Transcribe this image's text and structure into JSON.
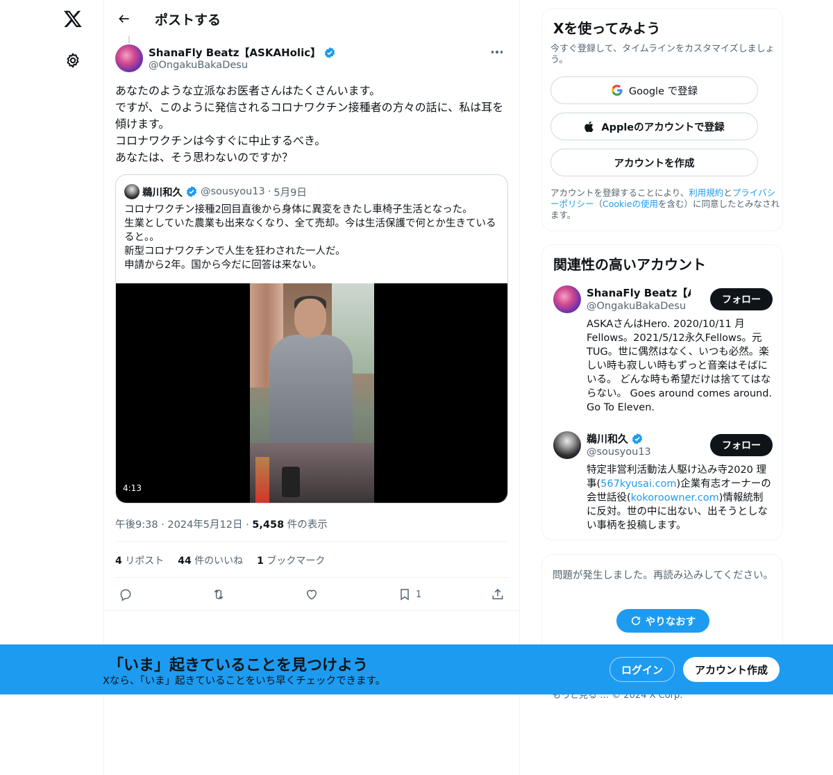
{
  "header": {
    "title": "ポストする"
  },
  "post": {
    "author_name": "ShanaFly Beatz【ASKAHolic】",
    "author_handle": "@OngakuBakaDesu",
    "text": "あなたのような立派なお医者さんはたくさんいます。\nですが、このように発信されるコロナワクチン接種者の方々の話に、私は耳を傾けます。\nコロナワクチンは今すぐに中止するべき。\nあなたは、そう思わないのですか？",
    "time": "午後9:38",
    "date": "2024年5月12日",
    "views_count": "5,458",
    "views_label": "件の表示",
    "reposts_count": "4",
    "reposts_label": "リポスト",
    "likes_count": "44",
    "likes_label": "件のいいね",
    "bookmarks_count": "1",
    "bookmarks_label": "ブックマーク",
    "action_bookmark_count": "1"
  },
  "quote": {
    "name": "鵜川和久",
    "handle": "@sousyou13",
    "date": "5月9日",
    "text": "コロナワクチン接種2回目直後から身体に異変をきたし車椅子生活となった。\n生業としていた農業も出来なくなり、全て売却。今は生活保護で何とか生きているると。。\n新型コロナワクチンで人生を狂わされた一人だ。\n申請から2年。国から今だに回答は来ない。",
    "video_duration": "4:13"
  },
  "signup_card": {
    "title": "Xを使ってみよう",
    "subtitle": "今すぐ登録して、タイムラインをカスタマイズしましょう。",
    "google_label": "Google で登録",
    "apple_label": "Appleのアカウントで登録",
    "create_label": "アカウントを作成",
    "legal_prefix": "アカウントを登録することにより、",
    "terms_link": "利用規約",
    "legal_and": "と",
    "privacy_link": "プライバシーポリシー",
    "legal_paren_open": "（",
    "cookie_link": "Cookieの使用",
    "legal_suffix": "を含む）に同意したとみなされます。"
  },
  "related": {
    "title": "関連性の高いアカウント",
    "follow_label": "フォロー",
    "accounts": [
      {
        "name": "ShanaFly Beatz【ASKAHolic】",
        "handle": "@OngakuBakaDesu",
        "bio": "ASKAさんはHero. 2020/10/11 月Fellows。2021/5/12永久Fellows。元TUG。世に偶然はなく、いつも必然。楽しい時も寂しい時もずっと音楽はそばにいる。 どんな時も希望だけは捨ててはならない。 Goes around comes around. Go To Eleven."
      },
      {
        "name": "鵜川和久",
        "handle": "@sousyou13",
        "bio_1": "特定非営利活動法人駆け込み寺2020 理事(",
        "bio_link_1": "567kyusai.com",
        "bio_2": ")企業有志オーナーの会世話役(",
        "bio_link_2": "kokoroowner.com",
        "bio_3": ")情報統制に反対。世の中に出ない、出そうとしない事柄を投稿します。"
      }
    ]
  },
  "error_card": {
    "message": "問題が発生しました。再読み込みしてください。",
    "retry_label": "やりなおす"
  },
  "footer": {
    "text": "もっと見る … © 2024 X Corp."
  },
  "banner": {
    "title": "「いま」起きていることを見つけよう",
    "subtitle": "Xなら、「いま」起きていることをいち早くチェックできます。",
    "login_label": "ログイン",
    "signup_label": "アカウント作成"
  },
  "icons": {
    "logo": "x-logo-icon",
    "settings": "gear-icon",
    "back": "arrow-left-icon",
    "verified": "verified-badge-icon",
    "more": "more-icon",
    "reply": "reply-icon",
    "repost": "repost-icon",
    "like": "heart-icon",
    "bookmark": "bookmark-icon",
    "share": "share-icon",
    "google": "google-icon",
    "apple": "apple-icon",
    "retry": "refresh-icon"
  },
  "colors": {
    "accent": "#1d9bf0",
    "text": "#0f1419",
    "muted": "#536471",
    "border": "#eff3f4"
  }
}
